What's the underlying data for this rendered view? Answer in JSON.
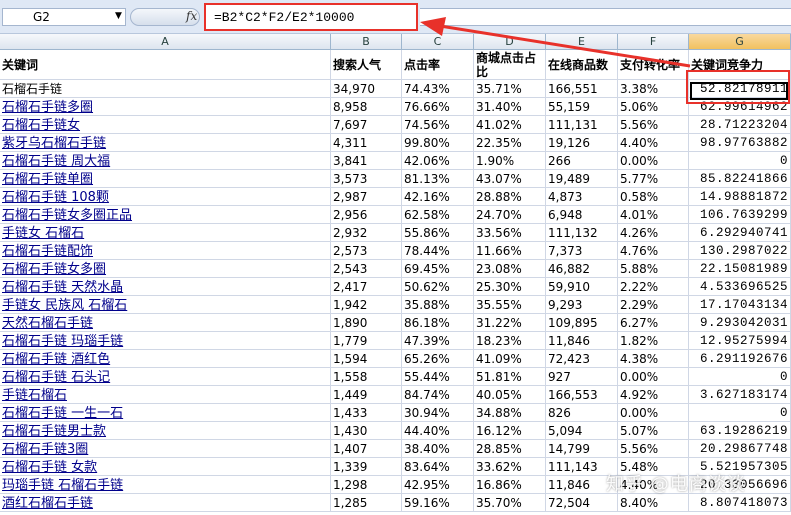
{
  "name_box": "G2",
  "formula": "=B2*C2*F2/E2*10000",
  "fx_label": "fx",
  "columns": [
    "A",
    "B",
    "C",
    "D",
    "E",
    "F",
    "G"
  ],
  "headers": [
    "关键词",
    "搜索人气",
    "点击率",
    "商城点击占比",
    "在线商品数",
    "支付转化率",
    "关键词竞争力"
  ],
  "rows": [
    [
      "石榴石手链",
      "34,970",
      "74.43%",
      "35.71%",
      "166,551",
      "3.38%",
      "52.82178911"
    ],
    [
      "石榴石手链多圈",
      "8,958",
      "76.66%",
      "31.40%",
      "55,159",
      "5.06%",
      "62.99614962"
    ],
    [
      "石榴石手链女",
      "7,697",
      "74.56%",
      "41.02%",
      "111,131",
      "5.56%",
      "28.71223204"
    ],
    [
      "紫牙乌石榴石手链",
      "4,311",
      "99.80%",
      "22.35%",
      "19,126",
      "4.40%",
      "98.97763882"
    ],
    [
      "石榴石手链 周大福",
      "3,841",
      "42.06%",
      "1.90%",
      "266",
      "0.00%",
      "0"
    ],
    [
      "石榴石手链单圈",
      "3,573",
      "81.13%",
      "43.07%",
      "19,489",
      "5.77%",
      "85.82241866"
    ],
    [
      "石榴石手链 108颗",
      "2,987",
      "42.16%",
      "28.88%",
      "4,873",
      "0.58%",
      "14.98881872"
    ],
    [
      "石榴石手链女多圈正品",
      "2,956",
      "62.58%",
      "24.70%",
      "6,948",
      "4.01%",
      "106.7639299"
    ],
    [
      "手链女 石榴石",
      "2,932",
      "55.86%",
      "33.56%",
      "111,132",
      "4.26%",
      "6.292940741"
    ],
    [
      "石榴石手链配饰",
      "2,573",
      "78.44%",
      "11.66%",
      "7,373",
      "4.76%",
      "130.2987022"
    ],
    [
      "石榴石手链女多圈",
      "2,543",
      "69.45%",
      "23.08%",
      "46,882",
      "5.88%",
      "22.15081989"
    ],
    [
      "石榴石手链 天然水晶",
      "2,417",
      "50.62%",
      "25.30%",
      "59,910",
      "2.22%",
      "4.533696525"
    ],
    [
      "手链女 民族风 石榴石",
      "1,942",
      "35.88%",
      "35.55%",
      "9,293",
      "2.29%",
      "17.17043134"
    ],
    [
      "天然石榴石手链",
      "1,890",
      "86.18%",
      "31.22%",
      "109,895",
      "6.27%",
      "9.293042031"
    ],
    [
      "石榴石手链 玛瑙手链",
      "1,779",
      "47.39%",
      "18.23%",
      "11,846",
      "1.82%",
      "12.95275994"
    ],
    [
      "石榴石手链 酒红色",
      "1,594",
      "65.26%",
      "41.09%",
      "72,423",
      "4.38%",
      "6.291192676"
    ],
    [
      "石榴石手链 石头记",
      "1,558",
      "55.44%",
      "51.81%",
      "927",
      "0.00%",
      "0"
    ],
    [
      "手链石榴石",
      "1,449",
      "84.74%",
      "40.05%",
      "166,553",
      "4.92%",
      "3.627183174"
    ],
    [
      "石榴石手链 一生一石",
      "1,433",
      "30.94%",
      "34.88%",
      "826",
      "0.00%",
      "0"
    ],
    [
      "石榴石手链男士款",
      "1,430",
      "44.40%",
      "16.12%",
      "5,094",
      "5.07%",
      "63.19286219"
    ],
    [
      "石榴石手链3圈",
      "1,407",
      "38.40%",
      "28.85%",
      "14,799",
      "5.56%",
      "20.29867748"
    ],
    [
      "石榴石手链 女款",
      "1,339",
      "83.64%",
      "33.62%",
      "111,143",
      "5.48%",
      "5.521957305"
    ],
    [
      "玛瑙手链 石榴石手链",
      "1,298",
      "42.95%",
      "16.86%",
      "11,846",
      "4.40%",
      "20.33056696"
    ],
    [
      "酒红石榴石手链",
      "1,285",
      "59.16%",
      "35.70%",
      "72,504",
      "8.40%",
      "8.807418073"
    ]
  ],
  "watermark": "知乎 @电商谈谈",
  "accent_color": "#e8312a"
}
